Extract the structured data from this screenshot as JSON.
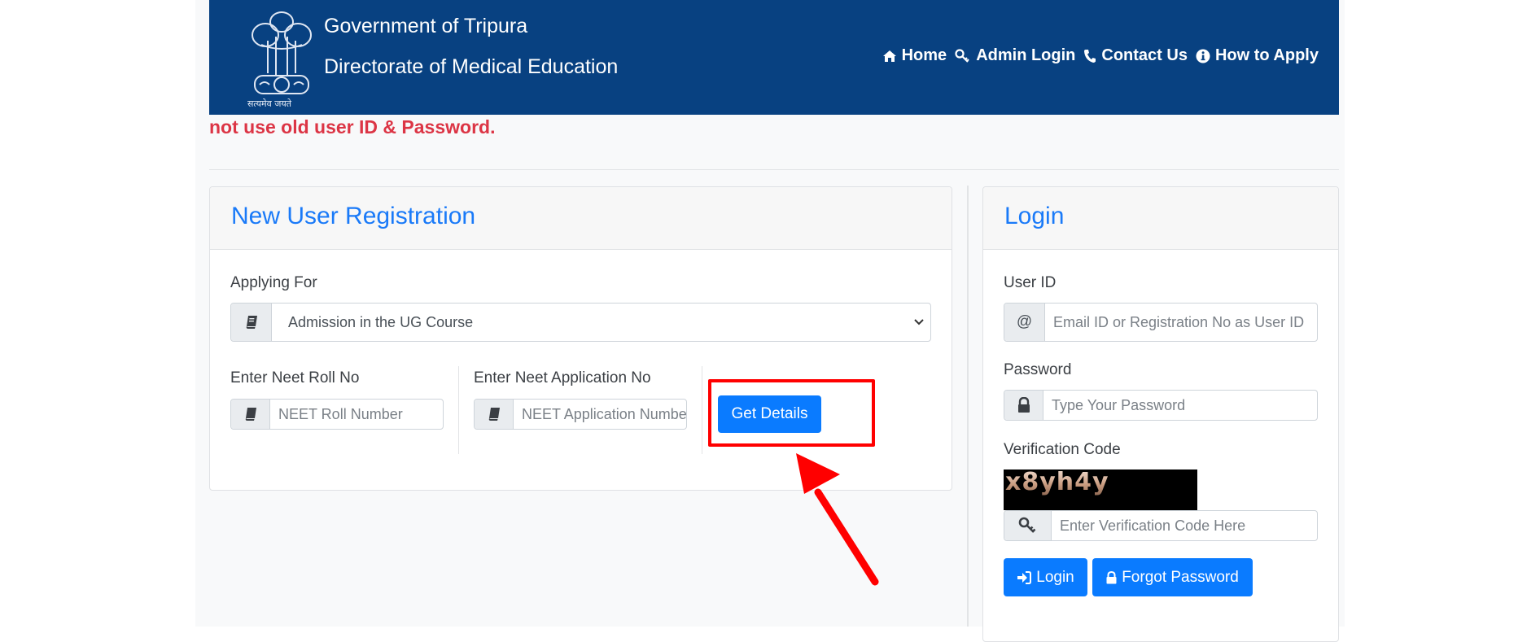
{
  "header": {
    "emblem_motto": "सत्यमेव जयते",
    "title_line1": "Government of Tripura",
    "title_line2": "Directorate of Medical Education",
    "nav": [
      {
        "label": "Home",
        "icon": "home-icon"
      },
      {
        "label": "Admin Login",
        "icon": "key-icon"
      },
      {
        "label": "Contact Us",
        "icon": "phone-icon"
      },
      {
        "label": "How to Apply",
        "icon": "info-circle-icon"
      }
    ]
  },
  "notice": {
    "text": "not use old user ID & Password."
  },
  "registration": {
    "title": "New User Registration",
    "applying_for_label": "Applying For",
    "applying_for_value": "Admission in the UG Course",
    "roll_label": "Enter Neet Roll No",
    "roll_placeholder": "NEET Roll Number",
    "appno_label": "Enter Neet Application No",
    "appno_placeholder": "NEET Application Number",
    "get_details_label": "Get Details"
  },
  "login": {
    "title": "Login",
    "userid_label": "User ID",
    "userid_addon": "@",
    "userid_placeholder": "Email ID or Registration No as User ID",
    "password_label": "Password",
    "password_placeholder": "Type Your Password",
    "verification_label": "Verification Code",
    "captcha_text": "x8yh4y",
    "verification_placeholder": "Enter Verification Code Here",
    "login_button": "Login",
    "forgot_button": "Forgot Password"
  },
  "colors": {
    "header_bg": "#084181",
    "accent": "#0a7bff",
    "notice": "#dc3545",
    "annotation": "#ff0000"
  }
}
